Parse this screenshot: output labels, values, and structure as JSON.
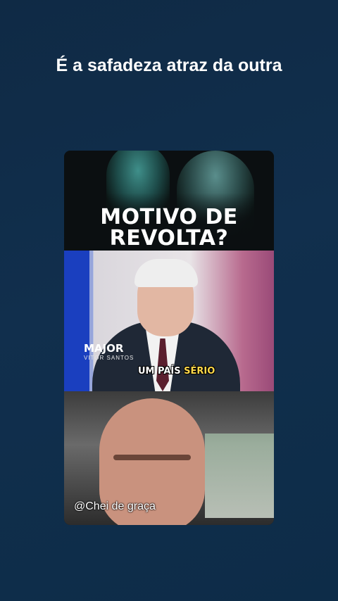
{
  "post": {
    "caption": "É a safadeza atraz da outra"
  },
  "media": {
    "panel1": {
      "headline_line1": "MOTIVO DE",
      "headline_line2": "REVOLTA?"
    },
    "panel2": {
      "brand": "MAJOR",
      "brand_sub": "VITOR SANTOS",
      "subtitle_prefix": "UM PAÍS ",
      "subtitle_highlight": "SÉRIO"
    },
    "panel3": {
      "watermark": "@Chei de graça"
    }
  },
  "colors": {
    "background": "#112f4d",
    "caption_text": "#ffffff",
    "subtitle_highlight": "#ffd84a"
  }
}
